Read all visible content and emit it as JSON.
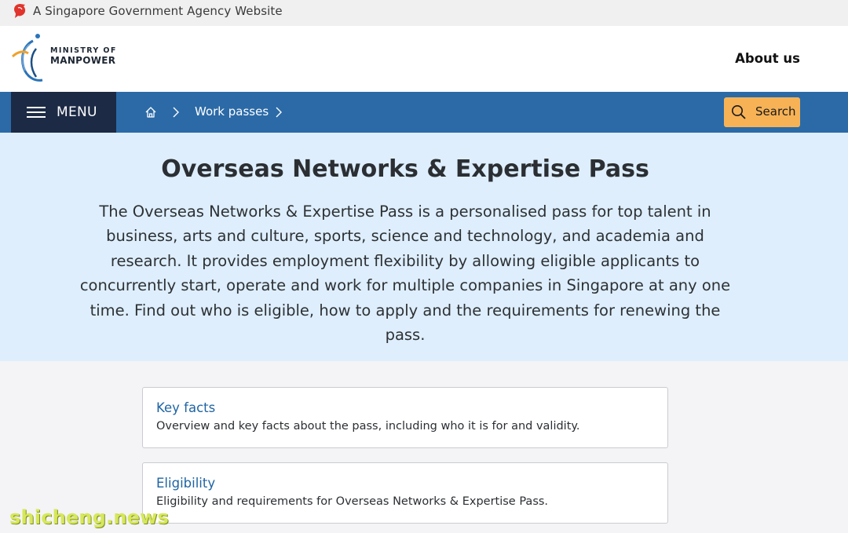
{
  "gov_bar": {
    "text": "A Singapore Government Agency Website",
    "icon": "lion-head-icon"
  },
  "logo": {
    "line1": "MINISTRY OF",
    "line2": "MANPOWER"
  },
  "header": {
    "about_label": "About us"
  },
  "nav": {
    "menu_label": "MENU",
    "breadcrumb": [
      "Work passes"
    ],
    "search_label": "Search"
  },
  "hero": {
    "title": "Overseas Networks & Expertise Pass",
    "description": "The Overseas Networks & Expertise Pass is a personalised pass for top talent in business, arts and culture, sports, science and technology, and academia and research. It provides employment flexibility by allowing eligible applicants to concurrently start, operate and work for multiple companies in Singapore at any one time. Find out who is eligible, how to apply and the requirements for renewing the pass."
  },
  "cards": [
    {
      "title": "Key facts",
      "description": "Overview and key facts about the pass, including who it is for and validity."
    },
    {
      "title": "Eligibility",
      "description": "Eligibility and requirements for Overseas Networks & Expertise Pass."
    }
  ],
  "watermark": "shicheng.news",
  "colors": {
    "nav": "#2b6aa7",
    "menu": "#1c2a45",
    "search": "#f7b256",
    "hero": "#deeefc",
    "link": "#1f64a3"
  }
}
